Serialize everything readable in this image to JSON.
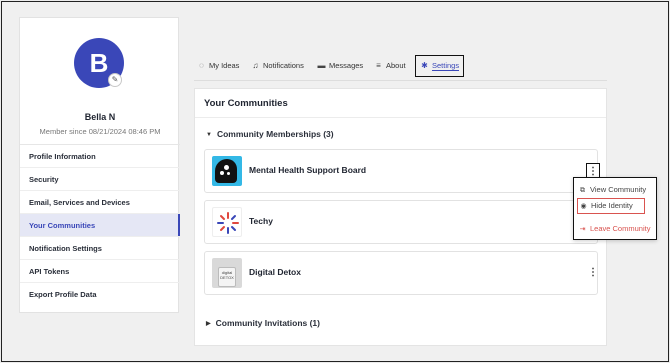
{
  "profile": {
    "avatar_letter": "B",
    "name": "Bella N",
    "member_since": "Member since 08/21/2024 08:46 PM"
  },
  "sidebar": {
    "items": [
      {
        "label": "Profile Information"
      },
      {
        "label": "Security"
      },
      {
        "label": "Email, Services and Devices"
      },
      {
        "label": "Your Communities",
        "active": true
      },
      {
        "label": "Notification Settings"
      },
      {
        "label": "API Tokens"
      },
      {
        "label": "Export Profile Data"
      }
    ]
  },
  "tabs": [
    {
      "label": "My Ideas",
      "icon": "lightbulb-icon"
    },
    {
      "label": "Notifications",
      "icon": "bell-icon"
    },
    {
      "label": "Messages",
      "icon": "chat-icon"
    },
    {
      "label": "About",
      "icon": "list-icon"
    },
    {
      "label": "Settings",
      "icon": "gear-icon",
      "active": true
    }
  ],
  "main": {
    "title": "Your Communities",
    "memberships_header": "Community Memberships (3)",
    "invitations_header": "Community Invitations (1)",
    "communities": [
      {
        "name": "Mental Health Support Board"
      },
      {
        "name": "Techy"
      },
      {
        "name": "Digital Detox",
        "thumb_text": "digital DETOX"
      }
    ]
  },
  "dropdown": {
    "items": [
      {
        "label": "View Community",
        "icon": "external-link-icon"
      },
      {
        "label": "Hide Identity",
        "icon": "eye-icon"
      },
      {
        "label": "Leave Community",
        "icon": "exit-icon"
      }
    ]
  },
  "colors": {
    "accent": "#3a47b8",
    "danger": "#d9534f",
    "highlight_border": "#111111"
  }
}
